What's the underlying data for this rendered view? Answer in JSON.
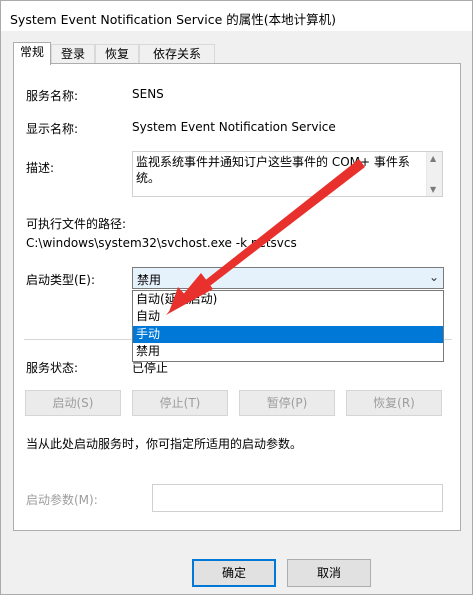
{
  "window": {
    "title": "System Event Notification Service 的属性(本地计算机)"
  },
  "tabs": [
    {
      "label": "常规"
    },
    {
      "label": "登录"
    },
    {
      "label": "恢复"
    },
    {
      "label": "依存关系"
    }
  ],
  "general": {
    "service_name_label": "服务名称:",
    "service_name_value": "SENS",
    "display_name_label": "显示名称:",
    "display_name_value": "System Event Notification Service",
    "description_label": "描述:",
    "description_value": "监视系统事件并通知订户这些事件的 COM+ 事件系统。",
    "exe_path_label": "可执行文件的路径:",
    "exe_path_value": "C:\\windows\\system32\\svchost.exe -k netsvcs",
    "startup_type_label": "启动类型(E):",
    "startup_type_value": "禁用",
    "startup_options": [
      "自动(延迟启动)",
      "自动",
      "手动",
      "禁用"
    ],
    "startup_highlighted": "手动",
    "service_status_label": "服务状态:",
    "service_status_value": "已停止",
    "start_button": "启动(S)",
    "stop_button": "停止(T)",
    "pause_button": "暂停(P)",
    "resume_button": "恢复(R)",
    "hint_text": "当从此处启动服务时，你可指定所适用的启动参数。",
    "start_params_label": "启动参数(M):",
    "start_params_value": ""
  },
  "footer": {
    "ok_label": "确定",
    "cancel_label": "取消"
  },
  "colors": {
    "accent": "#0078d7",
    "annotation_arrow": "#e8312d"
  }
}
